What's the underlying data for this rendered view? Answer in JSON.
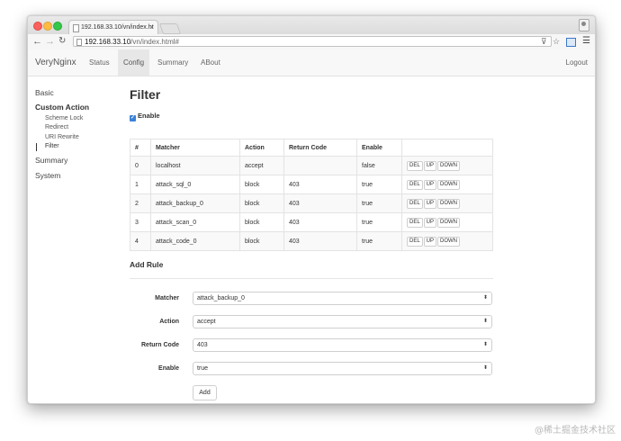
{
  "browser": {
    "tab_title": "192.168.33.10/vn/index.ht",
    "url_host": "192.168.33.10",
    "url_path": "/vn/index.html#"
  },
  "navbar": {
    "brand": "VeryNginx",
    "items": [
      {
        "label": "Status"
      },
      {
        "label": "Config"
      },
      {
        "label": "Summary"
      },
      {
        "label": "ABout"
      }
    ],
    "active": "Config",
    "logout": "Logout"
  },
  "sidebar": {
    "basic": "Basic",
    "custom_action": "Custom Action",
    "sub_items": [
      {
        "label": "Scheme Lock"
      },
      {
        "label": "Redirect"
      },
      {
        "label": "URI Rewrite"
      },
      {
        "label": "Filter"
      }
    ],
    "summary": "Summary",
    "system": "System"
  },
  "main": {
    "title": "Filter",
    "enable_label": "Enable",
    "enable_checked": true,
    "table": {
      "headers": [
        "#",
        "Matcher",
        "Action",
        "Return Code",
        "Enable",
        ""
      ],
      "rows": [
        {
          "idx": "0",
          "matcher": "localhost",
          "action": "accept",
          "code": "",
          "enable": "false"
        },
        {
          "idx": "1",
          "matcher": "attack_sql_0",
          "action": "block",
          "code": "403",
          "enable": "true"
        },
        {
          "idx": "2",
          "matcher": "attack_backup_0",
          "action": "block",
          "code": "403",
          "enable": "true"
        },
        {
          "idx": "3",
          "matcher": "attack_scan_0",
          "action": "block",
          "code": "403",
          "enable": "true"
        },
        {
          "idx": "4",
          "matcher": "attack_code_0",
          "action": "block",
          "code": "403",
          "enable": "true"
        }
      ],
      "buttons": {
        "del": "DEL",
        "up": "UP",
        "down": "DOWN"
      }
    },
    "add_rule": {
      "title": "Add Rule",
      "fields": [
        {
          "label": "Matcher",
          "value": "attack_backup_0"
        },
        {
          "label": "Action",
          "value": "accept"
        },
        {
          "label": "Return Code",
          "value": "403"
        },
        {
          "label": "Enable",
          "value": "true"
        }
      ],
      "add_button": "Add"
    }
  },
  "watermark": "@稀土掘金技术社区"
}
